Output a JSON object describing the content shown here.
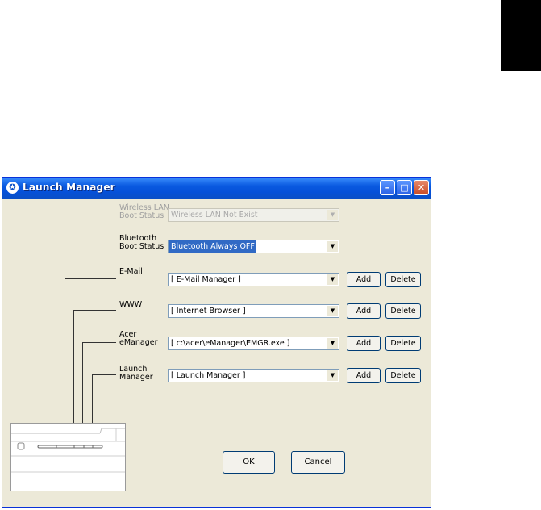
{
  "window": {
    "title": "Launch Manager"
  },
  "rows": [
    {
      "label1": "Wireless LAN",
      "label2": "Boot Status",
      "value": "Wireless LAN Not Exist",
      "disabled": true
    },
    {
      "label1": "Bluetooth",
      "label2": "Boot Status",
      "value": "Bluetooth Always OFF"
    },
    {
      "label1": "E-Mail",
      "label2": "",
      "value": "[  E-Mail Manager  ]",
      "add": "Add",
      "delete": "Delete"
    },
    {
      "label1": "WWW",
      "label2": "",
      "value": "[  Internet Browser  ]",
      "add": "Add",
      "delete": "Delete"
    },
    {
      "label1": "Acer",
      "label2": "eManager",
      "value": "[  c:\\acer\\eManager\\EMGR.exe  ]",
      "add": "Add",
      "delete": "Delete"
    },
    {
      "label1": "Launch",
      "label2": "Manager",
      "value": "[  Launch Manager  ]",
      "add": "Add",
      "delete": "Delete"
    }
  ],
  "buttons": {
    "ok": "OK",
    "cancel": "Cancel"
  },
  "icons": {
    "app": "launch-manager-icon",
    "minimize": "minimize-icon",
    "maximize": "maximize-icon",
    "close": "close-icon",
    "dropdown": "chevron-down-icon"
  },
  "colors": {
    "titlebar": "#0a5ae0",
    "dialog_bg": "#ece9d8",
    "selection": "#316ac5",
    "close_button": "#c94a25"
  }
}
